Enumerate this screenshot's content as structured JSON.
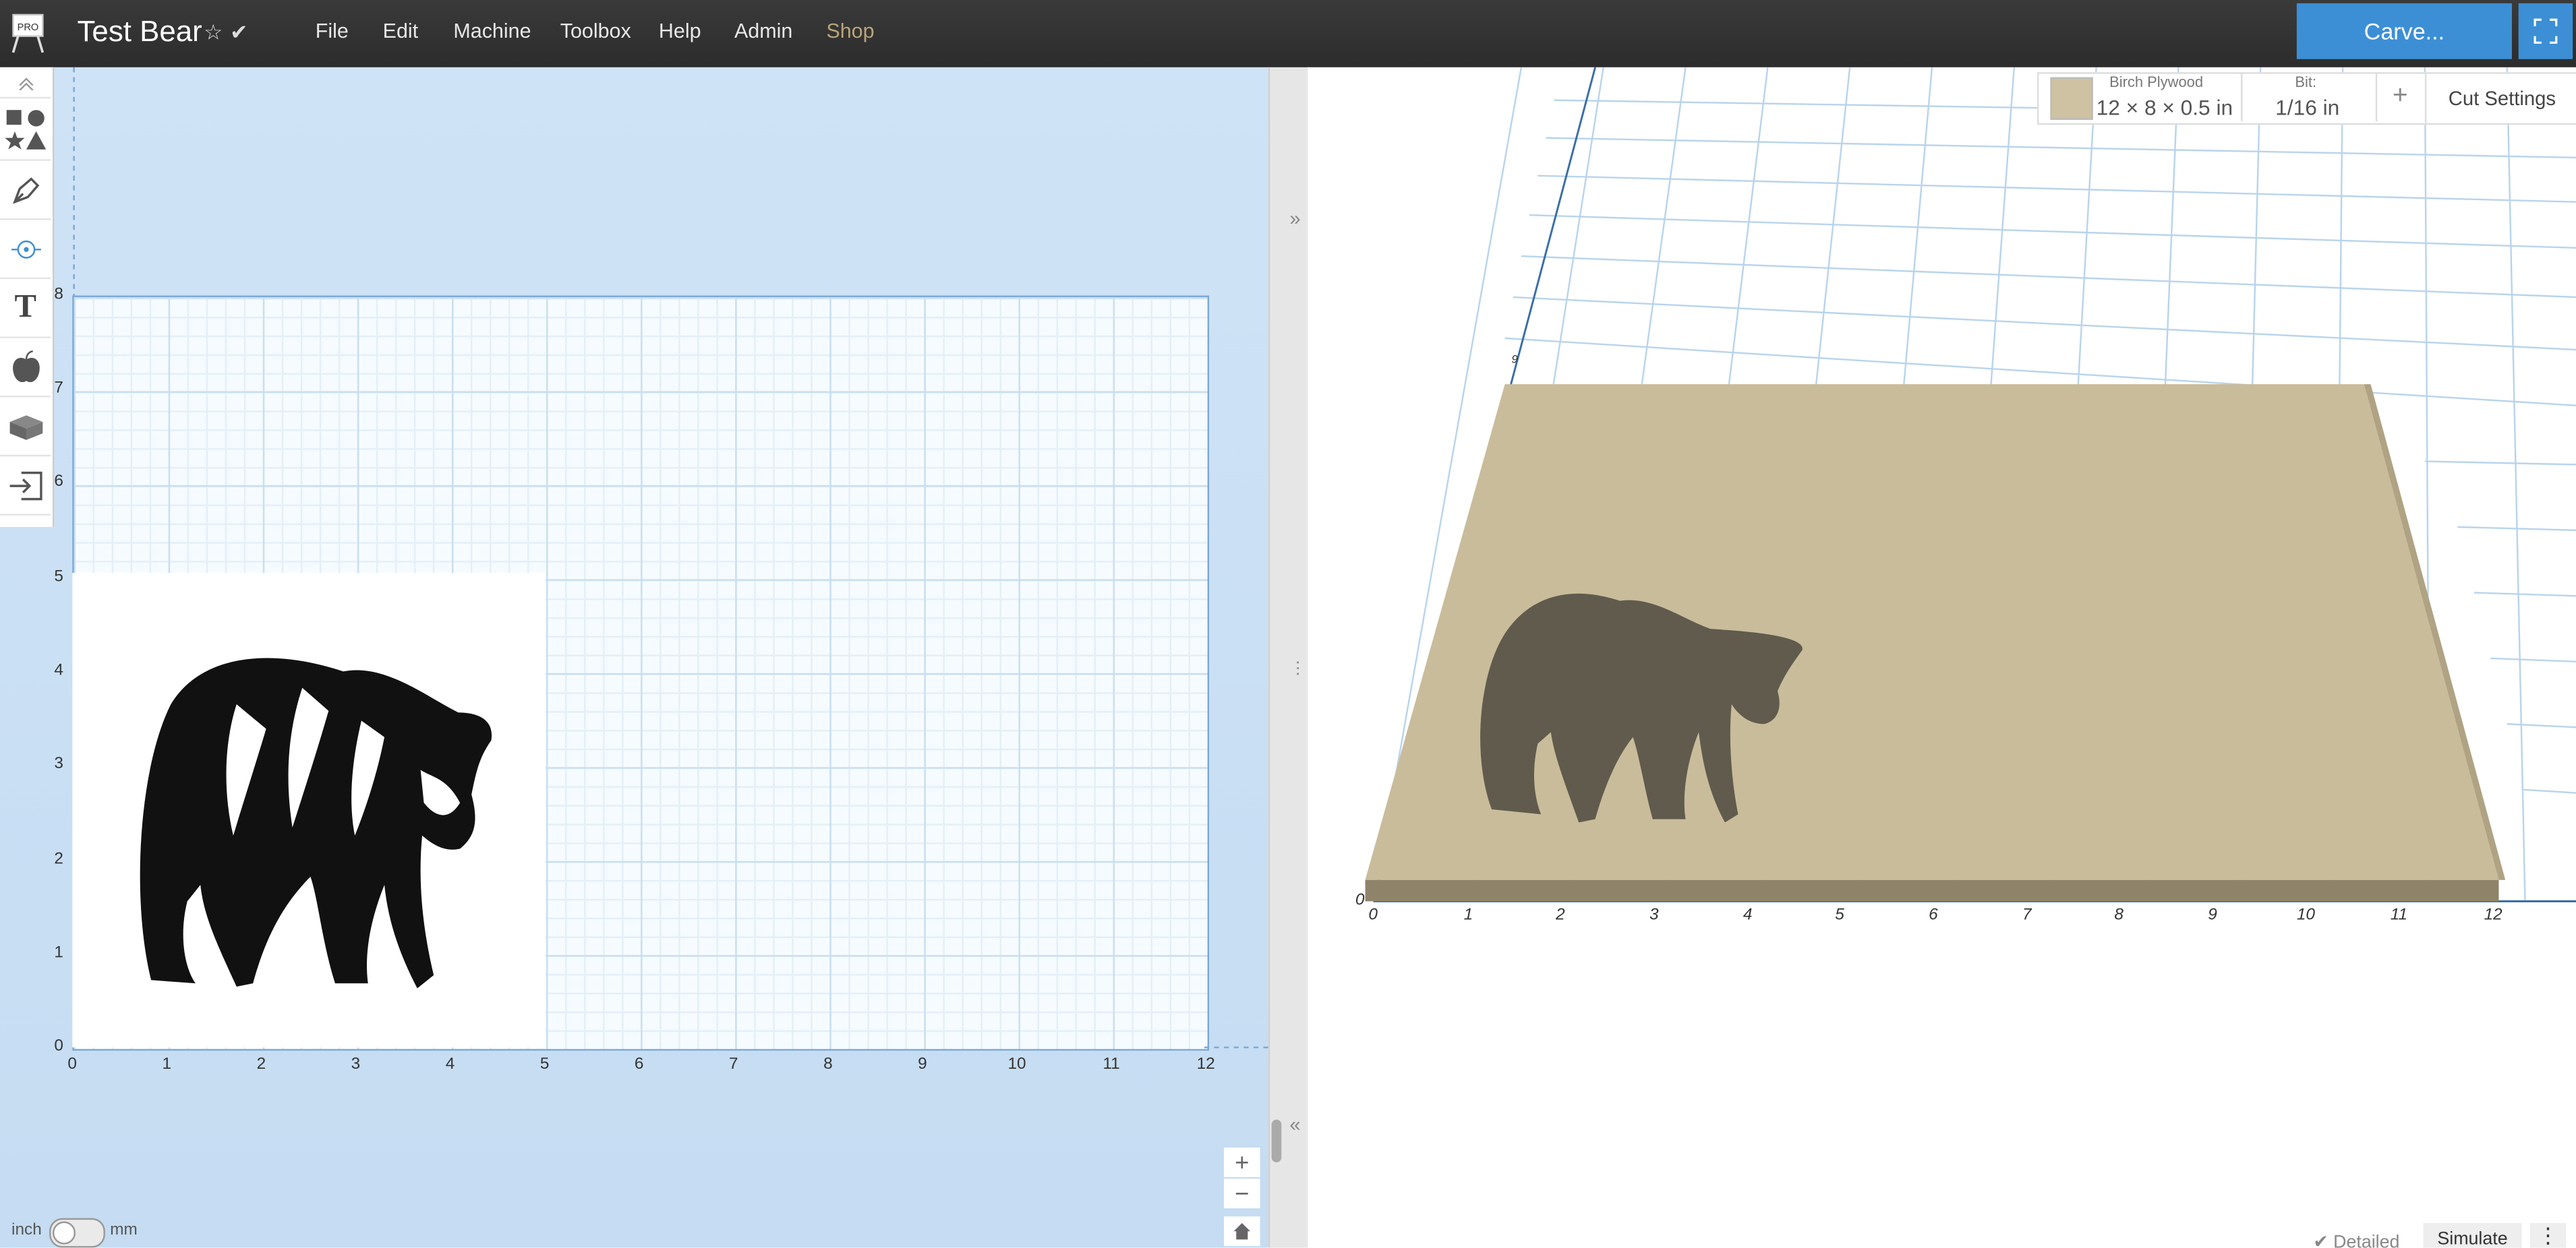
{
  "header": {
    "title": "Test Bear",
    "logo_text": "PRO",
    "menu": [
      "File",
      "Edit",
      "Machine",
      "Toolbox",
      "Help",
      "Admin",
      "Shop"
    ],
    "carve_label": "Carve..."
  },
  "toolbar": {
    "icons": [
      "collapse-icon",
      "shapes-icon",
      "pen-icon",
      "point-icon",
      "text-icon",
      "apple-icon",
      "box-icon",
      "import-icon"
    ]
  },
  "canvas": {
    "x_ticks": [
      "0",
      "1",
      "2",
      "3",
      "4",
      "5",
      "6",
      "7",
      "8",
      "9",
      "10",
      "11",
      "12"
    ],
    "y_ticks": [
      "0",
      "1",
      "2",
      "3",
      "4",
      "5",
      "6",
      "7",
      "8"
    ],
    "unit_left": "inch",
    "unit_right": "mm"
  },
  "material": {
    "name": "Birch Plywood",
    "size": "12 × 8 × 0.5 in",
    "bit_label": "Bit:",
    "bit_value": "1/16 in",
    "cut_settings_label": "Cut Settings"
  },
  "preview": {
    "x_ticks": [
      "0",
      "1",
      "2",
      "3",
      "4",
      "5",
      "6",
      "7",
      "8",
      "9",
      "10",
      "11",
      "12"
    ],
    "detailed_label": "Detailed",
    "simulate_label": "Simulate"
  },
  "colors": {
    "accent": "#3c8fd5",
    "topbar": "#2f2f2f",
    "wood": "#c9bc9a"
  }
}
